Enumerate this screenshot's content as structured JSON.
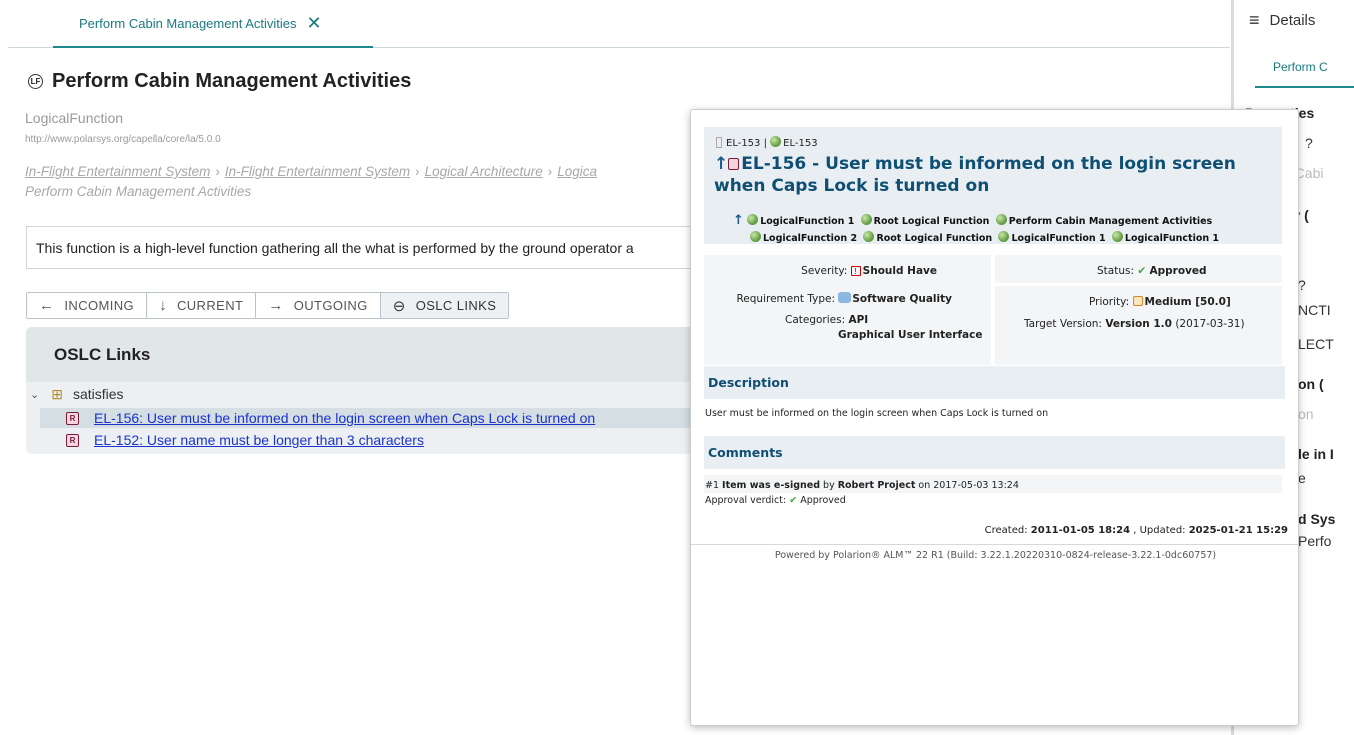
{
  "tab": {
    "label": "Perform Cabin Management Activities",
    "close": "✕"
  },
  "header": {
    "title": "Perform Cabin Management Activities",
    "type": "LogicalFunction",
    "uri": "http://www.polarsys.org/capella/core/la/5.0.0",
    "breadcrumb": [
      "In-Flight Entertainment System",
      "In-Flight Entertainment System",
      "Logical Architecture",
      "Logica"
    ],
    "breadcrumb_tail": "Perform Cabin Management Activities",
    "description": "This function is a high-level function gathering all the what is performed by the ground operator a"
  },
  "nav": [
    {
      "label": "INCOMING",
      "icon": "←"
    },
    {
      "label": "CURRENT",
      "icon": "↓"
    },
    {
      "label": "OUTGOING",
      "icon": "→"
    },
    {
      "label": "OSLC LINKS",
      "icon": "⊖"
    }
  ],
  "oslc": {
    "heading": "OSLC Links",
    "group": "satisfies",
    "items": [
      "EL-156: User must be informed on the login screen when Caps Lock is turned on",
      "EL-152: User name must be longer than 3 characters"
    ]
  },
  "details": {
    "title": "Details",
    "tab": "Perform C",
    "lines": [
      {
        "text": "Properties",
        "style": "bold"
      },
      {
        "text": "?",
        "style": "norm"
      },
      {
        "text": "n Cabi",
        "style": "grey"
      },
      {
        "text": "ry  (",
        "style": "bold"
      },
      {
        "text": "ry",
        "style": "grey"
      },
      {
        "text": "?",
        "style": "norm"
      },
      {
        "text": "NCTI",
        "style": "norm"
      },
      {
        "text": "LECT",
        "style": "norm"
      },
      {
        "text": "on  (",
        "style": "bold"
      },
      {
        "text": "on",
        "style": "grey"
      },
      {
        "text": "le in I",
        "style": "bold"
      },
      {
        "text": "e",
        "style": "norm"
      },
      {
        "text": "d Sys",
        "style": "bold"
      },
      {
        "text": "Perfo",
        "style": "norm"
      }
    ]
  },
  "popup": {
    "parent_ref": "EL-153 | ",
    "parent_ref2": "EL-153",
    "title_id": "EL-156",
    "title_text": " - User must be informed on the login screen when Caps Lock is turned on",
    "links_row1": [
      "LogicalFunction 1",
      "Root Logical Function",
      "Perform Cabin Management Activities"
    ],
    "links_row2": [
      "LogicalFunction 2",
      "Root Logical Function",
      "LogicalFunction 1",
      "LogicalFunction 1"
    ],
    "severity_label": "Severity:",
    "severity": "Should Have",
    "status_label": "Status:",
    "status": "Approved",
    "req_type_label": "Requirement Type:",
    "req_type": "Software Quality",
    "priority_label": "Priority:",
    "priority": "Medium [50.0]",
    "categories_label": "Categories:",
    "categories": [
      "API",
      "Graphical User Interface"
    ],
    "target_label": "Target Version:",
    "target_version": "Version 1.0",
    "target_date": " (2017-03-31)",
    "desc_heading": "Description",
    "desc_text": "User must be informed on the login screen when Caps Lock is turned on",
    "comments_heading": "Comments",
    "comment_prefix": "#1 ",
    "comment_bold": "Item was e-signed",
    "comment_by": " by ",
    "comment_author": "Robert Project",
    "comment_on": " on 2017-05-03 13:24",
    "verdict_label": "Approval verdict: ",
    "verdict": "Approved",
    "created_label": "Created: ",
    "created": "2011-01-05 18:24",
    "updated_label": " , Updated: ",
    "updated": "2025-01-21 15:29",
    "powered": "Powered by Polarion® ALM™ 22 R1 (Build: 3.22.1.20220310-0824-release-3.22.1-0dc60757)"
  }
}
